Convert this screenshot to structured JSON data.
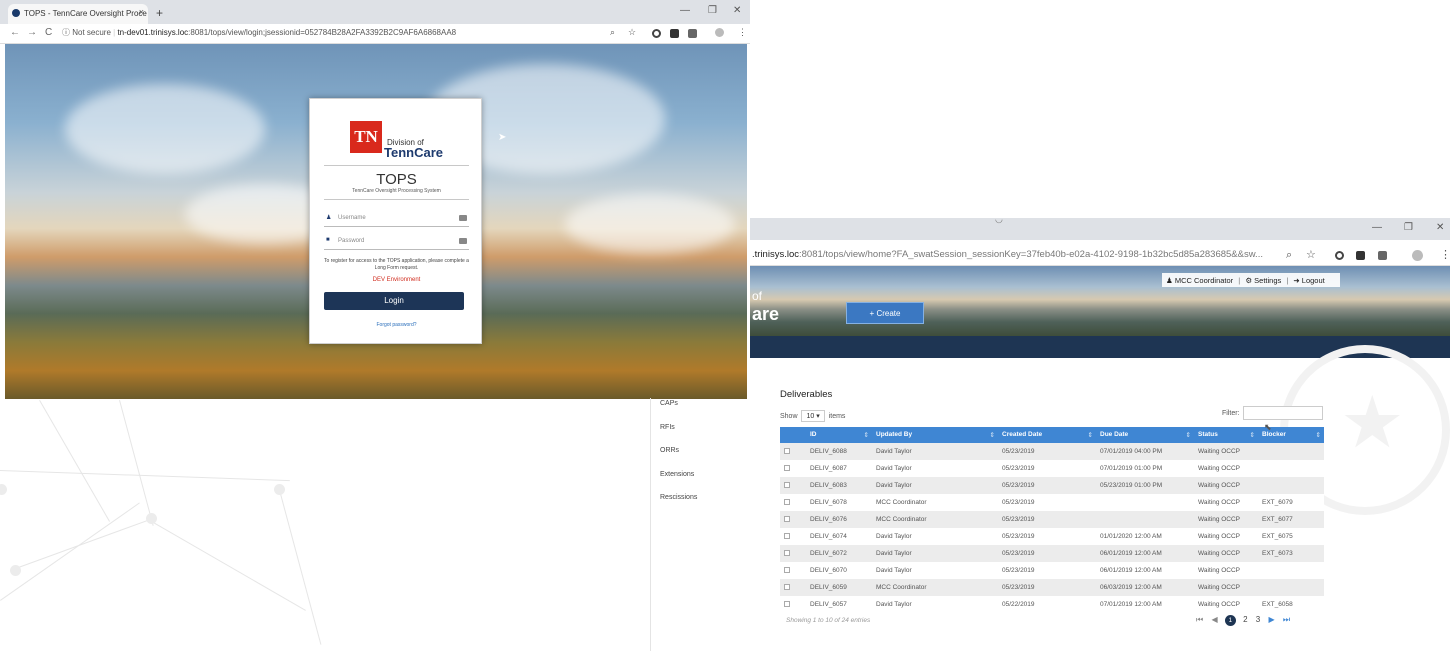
{
  "browser1": {
    "tab_title": "TOPS - TennCare Oversight Proce",
    "tab_close": "×",
    "new_tab": "+",
    "minimize": "—",
    "maximize": "❐",
    "close": "✕",
    "nav_back": "←",
    "nav_forward": "→",
    "nav_reload": "C",
    "security_label": "ⓘ Not secure",
    "url_host": "tn-dev01.trinisys.loc",
    "url_path": ":8081/tops/view/login;jsessionid=052784B28A2FA3392B2C9AF6A6868AA8",
    "zoom_icon": "⌕",
    "star_icon": "☆",
    "menu_icon": "⋮"
  },
  "login": {
    "logo_text": "TN",
    "division_of": "Division of",
    "brand": "TennCare",
    "app_name": "TOPS",
    "app_subtitle": "TennCare Oversight Processing System",
    "username_placeholder": "Username",
    "password_placeholder": "Password",
    "register_text": "To register for access to the TOPS application, please complete a Long Form request.",
    "environment": "DEV Environment",
    "login_button": "Login",
    "forgot_link": "Forgot password?"
  },
  "sidebar": {
    "items": [
      "CAPs",
      "RFIs",
      "ORRs",
      "Extensions",
      "Rescissions"
    ]
  },
  "browser2": {
    "url_host": ".trinisys.loc",
    "url_path": ":8081/tops/view/home?FA_swatSession_sessionKey=37feb40b-e02a-4102-9198-1b32bc5d85a283685&&sw...",
    "minimize": "—",
    "maximize": "❐",
    "close": "✕"
  },
  "header": {
    "brand_of": "of",
    "brand_care": "are",
    "create_button": "+ Create",
    "user_role": "MCC Coordinator",
    "settings": "Settings",
    "logout": "Logout"
  },
  "deliverables": {
    "title": "Deliverables",
    "show_label": "Show",
    "page_size": "10",
    "items_label": "items",
    "filter_label": "Filter:",
    "columns": [
      "ID",
      "Updated By",
      "Created Date",
      "Due Date",
      "Status",
      "Blocker"
    ],
    "rows": [
      {
        "id": "DELIV_6088",
        "updated_by": "David Taylor",
        "created": "05/23/2019",
        "due": "07/01/2019 04:00 PM",
        "status": "Waiting OCCP",
        "blocker": ""
      },
      {
        "id": "DELIV_6087",
        "updated_by": "David Taylor",
        "created": "05/23/2019",
        "due": "07/01/2019 01:00 PM",
        "status": "Waiting OCCP",
        "blocker": ""
      },
      {
        "id": "DELIV_6083",
        "updated_by": "David Taylor",
        "created": "05/23/2019",
        "due": "05/23/2019 01:00 PM",
        "status": "Waiting OCCP",
        "blocker": ""
      },
      {
        "id": "DELIV_6078",
        "updated_by": "MCC Coordinator",
        "created": "05/23/2019",
        "due": "",
        "status": "Waiting OCCP",
        "blocker": "EXT_6079"
      },
      {
        "id": "DELIV_6076",
        "updated_by": "MCC Coordinator",
        "created": "05/23/2019",
        "due": "",
        "status": "Waiting OCCP",
        "blocker": "EXT_6077"
      },
      {
        "id": "DELIV_6074",
        "updated_by": "David Taylor",
        "created": "05/23/2019",
        "due": "01/01/2020 12:00 AM",
        "status": "Waiting OCCP",
        "blocker": "EXT_6075"
      },
      {
        "id": "DELIV_6072",
        "updated_by": "David Taylor",
        "created": "05/23/2019",
        "due": "06/01/2019 12:00 AM",
        "status": "Waiting OCCP",
        "blocker": "EXT_6073"
      },
      {
        "id": "DELIV_6070",
        "updated_by": "David Taylor",
        "created": "05/23/2019",
        "due": "06/01/2019 12:00 AM",
        "status": "Waiting OCCP",
        "blocker": ""
      },
      {
        "id": "DELIV_6059",
        "updated_by": "MCC Coordinator",
        "created": "05/23/2019",
        "due": "06/03/2019 12:00 AM",
        "status": "Waiting OCCP",
        "blocker": ""
      },
      {
        "id": "DELIV_6057",
        "updated_by": "David Taylor",
        "created": "05/22/2019",
        "due": "07/01/2019 12:00 AM",
        "status": "Waiting OCCP",
        "blocker": "EXT_6058"
      }
    ],
    "showing_text": "Showing 1 to 10 of 24 entries",
    "pager": {
      "first": "⏮",
      "prev": "◀",
      "pages": [
        "1",
        "2",
        "3"
      ],
      "next": "▶",
      "last": "⏭"
    }
  }
}
